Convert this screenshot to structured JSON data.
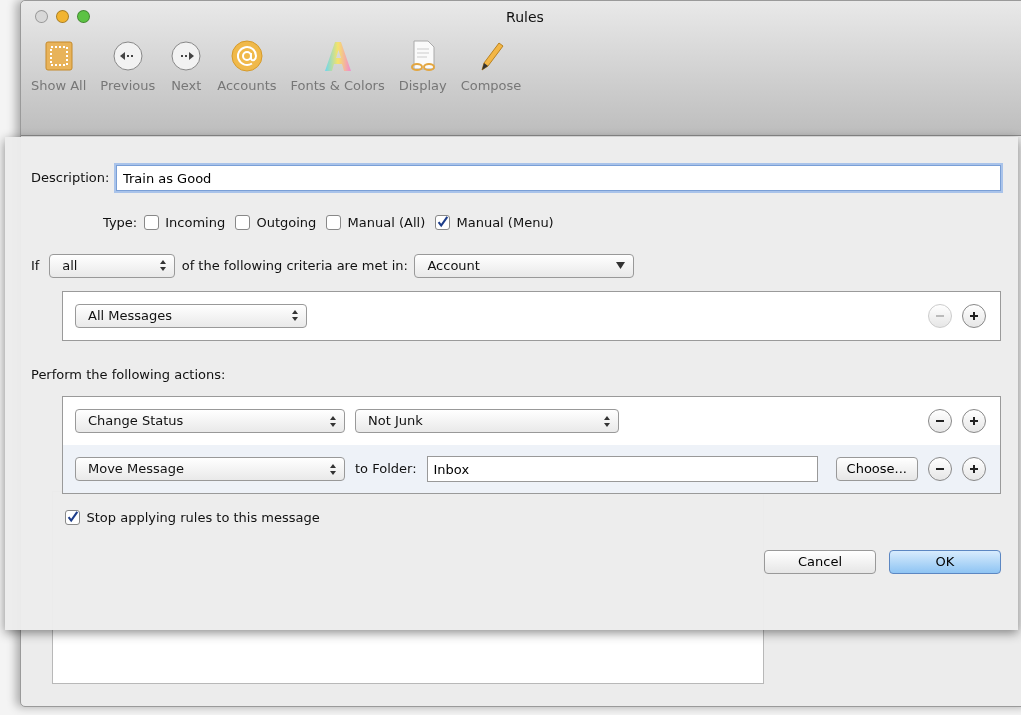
{
  "window": {
    "title": "Rules"
  },
  "toolbar": {
    "items": [
      {
        "kind": "general",
        "label": "Show All"
      },
      {
        "kind": "previous",
        "label": "Previous"
      },
      {
        "kind": "next",
        "label": "Next"
      },
      {
        "kind": "accounts",
        "label": "Accounts"
      },
      {
        "kind": "fonts",
        "label": "Fonts & Colors"
      },
      {
        "kind": "display",
        "label": "Display"
      },
      {
        "kind": "compose",
        "label": "Compose"
      }
    ]
  },
  "sheet": {
    "description": {
      "label": "Description:",
      "value": "Train as Good"
    },
    "type": {
      "label": "Type:",
      "options": [
        {
          "label": "Incoming",
          "checked": false
        },
        {
          "label": "Outgoing",
          "checked": false
        },
        {
          "label": "Manual (All)",
          "checked": false
        },
        {
          "label": "Manual (Menu)",
          "checked": true
        }
      ]
    },
    "criteria": {
      "if_label": "If",
      "match": "all",
      "text": "of the following criteria are met in:",
      "scope": "Account"
    },
    "conditions": [
      {
        "field": "All Messages",
        "remove_disabled": true
      }
    ],
    "actions_label": "Perform the following actions:",
    "actions": [
      {
        "kind": "select",
        "action": "Change Status",
        "value": "Not Junk",
        "remove_disabled": false
      },
      {
        "kind": "folder",
        "action": "Move Message",
        "folder_label": "to Folder:",
        "folder": "Inbox",
        "choose": "Choose...",
        "remove_disabled": false
      }
    ],
    "stop": {
      "label": "Stop applying rules to this message",
      "checked": true
    },
    "buttons": [
      {
        "label": "Cancel",
        "default": false
      },
      {
        "label": "OK",
        "default": true
      }
    ]
  }
}
